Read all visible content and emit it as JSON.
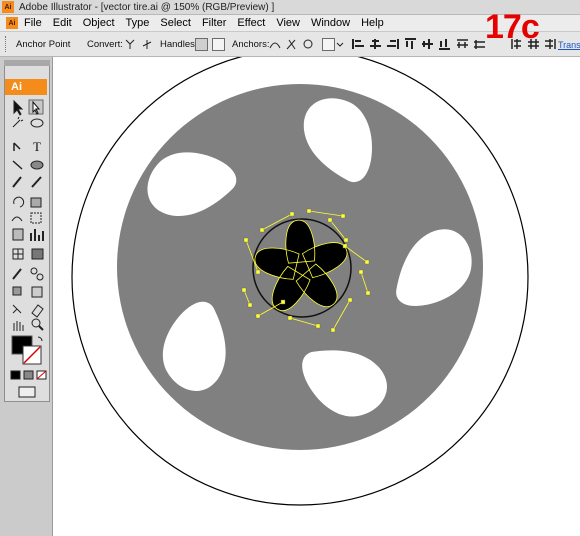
{
  "window": {
    "title": "Adobe Illustrator - [vector tire.ai @ 150% (RGB/Preview) ]",
    "app_icon": "Ai"
  },
  "menubar": {
    "items": [
      "File",
      "Edit",
      "Object",
      "Type",
      "Select",
      "Filter",
      "Effect",
      "View",
      "Window",
      "Help"
    ]
  },
  "control_bar": {
    "anchor_point_label": "Anchor Point",
    "convert_label": "Convert:",
    "handles_label": "Handles:",
    "anchors_label": "Anchors:",
    "transform_link": "Transfo"
  },
  "overlay": {
    "step_label": "17c",
    "color": "#e60000"
  },
  "toolbox": {
    "logo": "Ai",
    "logo_color": "#f48c1c"
  },
  "artwork": {
    "tire_outline_color": "#000000",
    "rim_color": "#808080",
    "hub_color": "#000000",
    "selection_color": "#ffff33",
    "spoke_holes": 5,
    "hub_lobes": 5
  }
}
